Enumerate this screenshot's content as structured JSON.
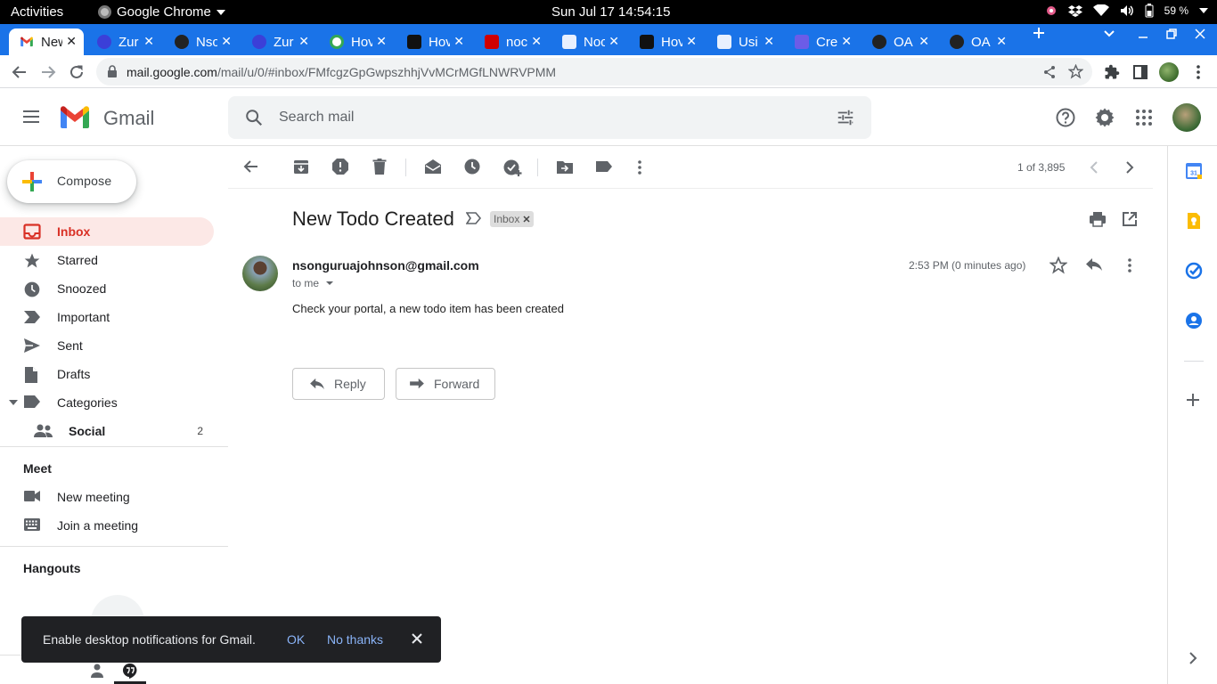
{
  "system": {
    "activities": "Activities",
    "app_name": "Google Chrome",
    "clock": "Sun Jul 17  14:54:15",
    "battery": "59 %"
  },
  "tabs": [
    {
      "title": "New",
      "favicon": "gmail-icon",
      "color": "#ea4335",
      "active": true
    },
    {
      "title": "Zur",
      "favicon": "globe-icon",
      "color": "#3b3fd8"
    },
    {
      "title": "Nso",
      "favicon": "github-icon",
      "color": "#222222"
    },
    {
      "title": "Zur",
      "favicon": "globe-icon",
      "color": "#3b3fd8"
    },
    {
      "title": "Hov",
      "favicon": "google-icon",
      "color": "#ffffff"
    },
    {
      "title": "Hov",
      "favicon": "htg-icon",
      "color": "#111111"
    },
    {
      "title": "noc",
      "favicon": "n-icon",
      "color": "#d00000"
    },
    {
      "title": "Noc",
      "favicon": "doc-icon",
      "color": "#e8f0fe"
    },
    {
      "title": "Hov",
      "favicon": "a-icon",
      "color": "#111111"
    },
    {
      "title": "Usi",
      "favicon": "doc-icon",
      "color": "#e8f0fe"
    },
    {
      "title": "Cre",
      "favicon": "purple-icon",
      "color": "#6c5ce7"
    },
    {
      "title": "OA",
      "favicon": "openai-icon",
      "color": "#222222"
    },
    {
      "title": "OA",
      "favicon": "openai-icon",
      "color": "#222222"
    }
  ],
  "browser": {
    "url_host": "mail.google.com",
    "url_path": "/mail/u/0/#inbox/FMfcgzGpGwpszhhjVvMCrMGfLNWRVPMM"
  },
  "gmail": {
    "logo_text": "Gmail",
    "search_placeholder": "Search mail",
    "compose_label": "Compose",
    "nav": [
      {
        "label": "Inbox",
        "icon": "inbox-icon",
        "active": true
      },
      {
        "label": "Starred",
        "icon": "star-icon"
      },
      {
        "label": "Snoozed",
        "icon": "clock-icon"
      },
      {
        "label": "Important",
        "icon": "important-icon"
      },
      {
        "label": "Sent",
        "icon": "send-icon"
      },
      {
        "label": "Drafts",
        "icon": "draft-icon"
      },
      {
        "label": "Categories",
        "icon": "label-icon"
      },
      {
        "label": "Social",
        "icon": "people-icon",
        "count": "2"
      }
    ],
    "meet": {
      "heading": "Meet",
      "items": [
        {
          "label": "New meeting",
          "icon": "video-icon"
        },
        {
          "label": "Join a meeting",
          "icon": "keyboard-icon"
        }
      ]
    },
    "hangouts_heading": "Hangouts",
    "pager": "1 of 3,895",
    "message": {
      "subject": "New Todo Created",
      "label": "Inbox",
      "sender": "nsonguruajohnson@gmail.com",
      "to": "to me",
      "time": "2:53 PM (0 minutes ago)",
      "body": "Check your portal, a new todo item has been created",
      "reply_label": "Reply",
      "forward_label": "Forward"
    },
    "snackbar": {
      "message": "Enable desktop notifications for Gmail.",
      "ok": "OK",
      "no_thanks": "No thanks"
    }
  },
  "colors": {
    "chrome_blue": "#1a73e8",
    "gmail_red": "#d93025",
    "active_nav_bg": "#fce8e6"
  }
}
